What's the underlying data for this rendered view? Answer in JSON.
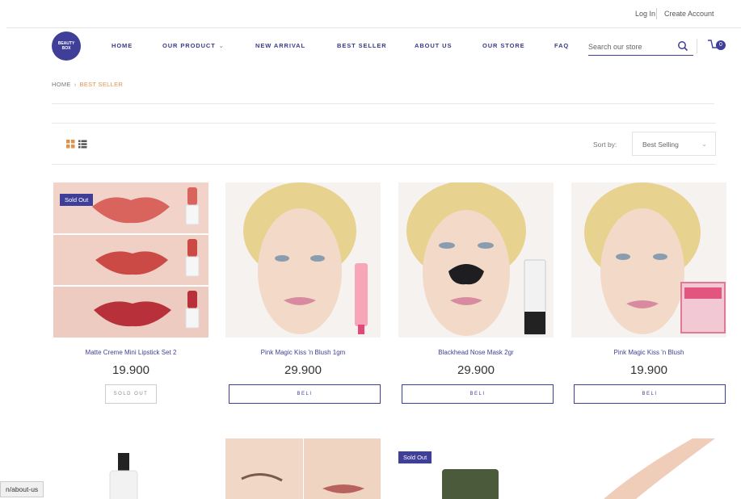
{
  "topbar": {
    "login": "Log In",
    "create_account": "Create Account"
  },
  "logo": {
    "line1": "BEAUTY",
    "line2": "BOX"
  },
  "nav": {
    "items": [
      {
        "label": "HOME",
        "has_caret": false
      },
      {
        "label": "OUR PRODUCT",
        "has_caret": true
      },
      {
        "label": "NEW ARRIVAL",
        "has_caret": false
      },
      {
        "label": "BEST SELLER",
        "has_caret": false
      },
      {
        "label": "ABOUT US",
        "has_caret": false
      },
      {
        "label": "OUR STORE",
        "has_caret": false
      },
      {
        "label": "FAQ",
        "has_caret": false
      }
    ],
    "search_placeholder": "Search our store",
    "cart_count": "0"
  },
  "breadcrumb": {
    "home": "HOME",
    "separator": "›",
    "current": "BEST SELLER"
  },
  "toolbar": {
    "sort_label": "Sort by:",
    "sort_value": "Best Selling",
    "chevron": "⌄"
  },
  "products": [
    {
      "name": "Matte Creme Mini Lipstick Set 2",
      "price": "19.900",
      "button": "SOLD OUT",
      "sold_out": true,
      "sold_label": "Sold Out"
    },
    {
      "name": "Pink Magic Kiss 'n Blush 1gm",
      "price": "29.900",
      "button": "BELI",
      "sold_out": false
    },
    {
      "name": "Blackhead Nose Mask 2gr",
      "price": "29.900",
      "button": "BELI",
      "sold_out": false
    },
    {
      "name": "Pink Magic Kiss 'n Blush",
      "price": "19.900",
      "button": "BELI",
      "sold_out": false
    }
  ],
  "row2": {
    "sold_label": "Sold Out"
  },
  "status_bar": {
    "url": "n/about-us"
  },
  "colors": {
    "brand": "#3f3f9a",
    "accent": "#e0924a"
  }
}
